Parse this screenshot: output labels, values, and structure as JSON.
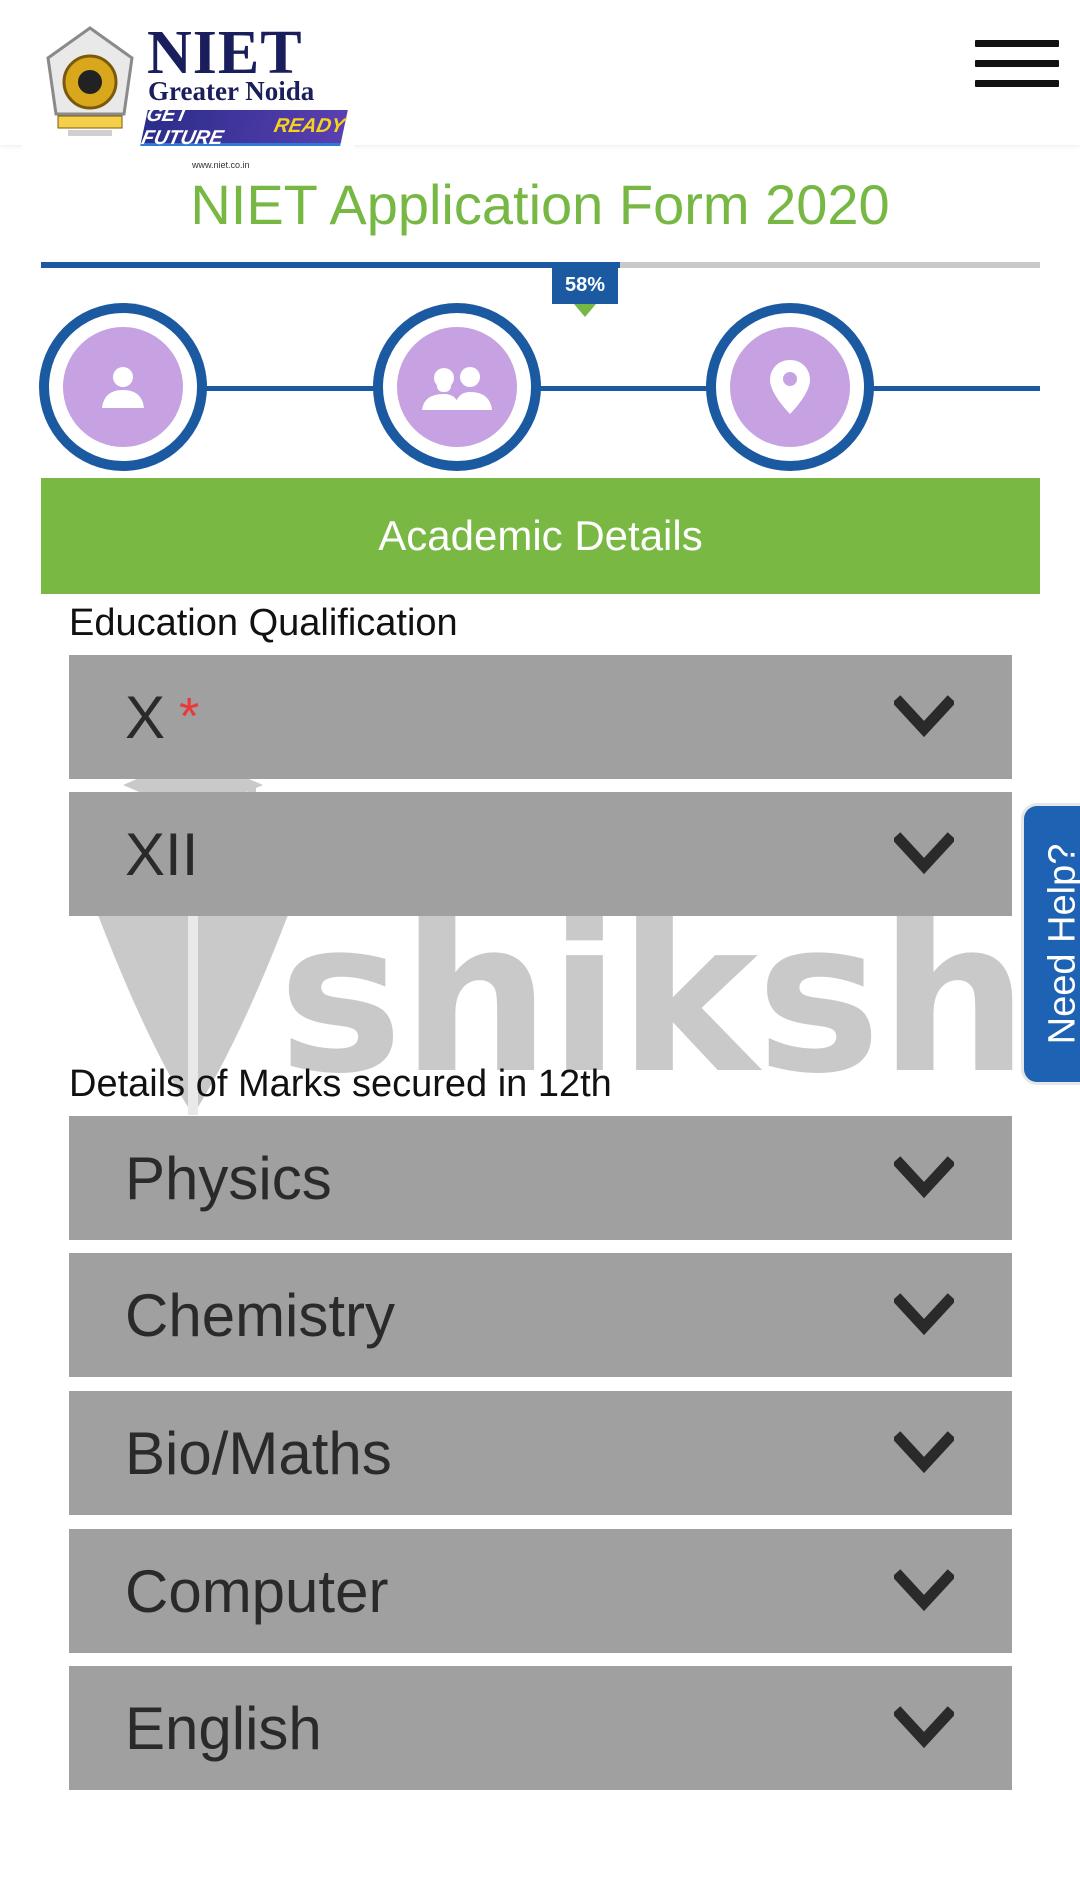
{
  "header": {
    "logo": {
      "name": "NIET",
      "subtitle": "Greater Noida",
      "tag_part1": "GET FUTURE",
      "tag_part2": "READY",
      "url": "www.niet.co.in"
    },
    "menu_icon": "hamburger-icon"
  },
  "form": {
    "title": "NIET Application Form 2020",
    "progress": {
      "percent": 58,
      "label": "58%"
    },
    "steps": [
      {
        "icon": "user-icon"
      },
      {
        "icon": "parents-icon"
      },
      {
        "icon": "location-pin-icon"
      }
    ],
    "section_title": "Academic Details",
    "education": {
      "label": "Education Qualification",
      "fields": [
        {
          "label": "X",
          "required_mark": "*"
        },
        {
          "label": "XII"
        }
      ]
    },
    "marks": {
      "label": "Details of Marks secured in 12th",
      "fields": [
        {
          "label": "Physics"
        },
        {
          "label": "Chemistry"
        },
        {
          "label": "Bio/Maths"
        },
        {
          "label": "Computer"
        },
        {
          "label": "English"
        }
      ]
    }
  },
  "watermark": {
    "text": "shiksha"
  },
  "help": {
    "label": "Need Help?"
  },
  "colors": {
    "brand_green": "#76b843",
    "brand_blue": "#1b5aa1",
    "step_purple": "#c6a2e2",
    "field_gray": "#a0a0a0",
    "required_red": "#e83a3a"
  }
}
